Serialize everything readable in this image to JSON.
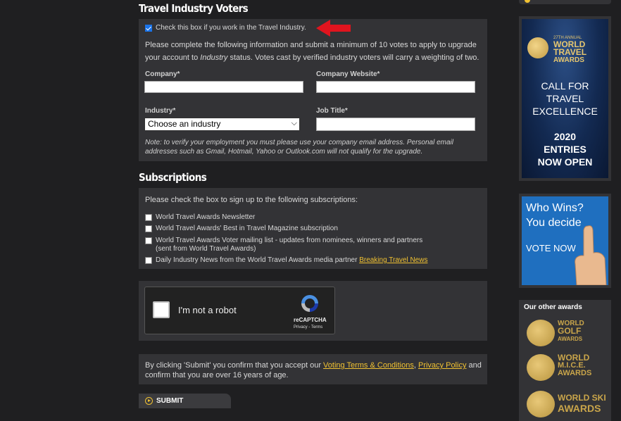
{
  "travel_industry": {
    "title": "Travel Industry Voters",
    "checkbox_label": "Check this box if you work in the Travel Industry.",
    "intro_part1": "Please complete the following information and submit a minimum of 10 votes to apply to upgrade your account to ",
    "intro_italic": "Industry",
    "intro_part2": " status. Votes cast by verified industry voters will carry a weighting of two.",
    "company_label": "Company*",
    "company_value": "",
    "website_label": "Company Website*",
    "website_value": "",
    "industry_label": "Industry*",
    "industry_selected": "Choose an industry",
    "jobtitle_label": "Job Title*",
    "jobtitle_value": "",
    "note": "Note: to verify your employment you must please use your company email address. Personal email addresses such as Gmail, Hotmail, Yahoo or Outlook.com will not qualify for the upgrade."
  },
  "subscriptions": {
    "title": "Subscriptions",
    "intro": "Please check the box to sign up to the following subscriptions:",
    "item1": "World Travel Awards Newsletter",
    "item2": "World Travel Awards' Best in Travel Magazine subscription",
    "item3_line1": "World Travel Awards Voter mailing list - updates from nominees, winners and partners",
    "item3_line2": "(sent from World Travel Awards)",
    "item4": "Daily Industry News from the World Travel Awards media partner ",
    "item4_link": "Breaking Travel News"
  },
  "captcha": {
    "label": "I'm not a robot",
    "brand": "reCAPTCHA",
    "links": "Privacy - Terms"
  },
  "terms": {
    "part1": "By clicking 'Submit' you confirm that you accept our ",
    "link1": "Voting Terms & Conditions",
    "sep": ", ",
    "link2": "Privacy Policy",
    "part2": " and confirm that you are over 16 years of age."
  },
  "submit_label": "SUBMIT",
  "ad1": {
    "anniv": "27TH ANNUAL",
    "brand_line1": "WORLD",
    "brand_line2": "TRAVEL",
    "brand_line3": "AWARDS",
    "call_line1": "CALL FOR",
    "call_line2": "TRAVEL",
    "call_line3": "EXCELLENCE",
    "year": "2020",
    "entries_line1": "ENTRIES",
    "entries_line2": "NOW OPEN"
  },
  "ad2": {
    "line1": "Who Wins?",
    "line2": "You decide",
    "cta": "VOTE NOW"
  },
  "other_awards": {
    "title": "Our other awards",
    "golf": [
      "WORLD",
      "GOLF",
      "AWARDS"
    ],
    "mice": [
      "WORLD",
      "M.I.C.E.",
      "AWARDS"
    ],
    "ski": [
      "WORLD SKI",
      "AWARDS"
    ]
  },
  "colors": {
    "accent": "#f1c232",
    "panel": "#333336",
    "background": "#1f1f21",
    "arrow": "#e0141e"
  }
}
